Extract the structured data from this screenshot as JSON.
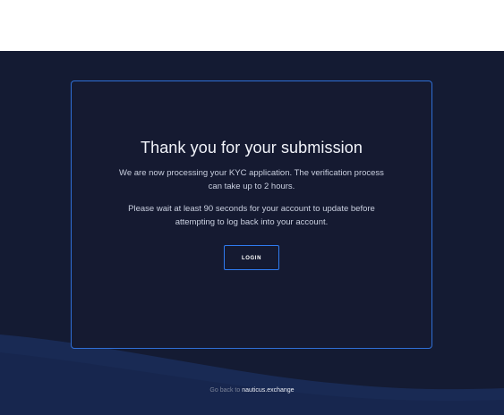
{
  "confirmation": {
    "title": "Thank you for your submission",
    "paragraph_1": "We are now processing your KYC application. The verification process can take up to 2 hours.",
    "paragraph_2": "Please wait at least 90 seconds for your account to update before attempting to log back into your account.",
    "login_label": "LOGIN"
  },
  "footer": {
    "prefix": "Go back to ",
    "link_text": "nauticus.exchange"
  },
  "colors": {
    "background": "#141b33",
    "card_background": "#151a31",
    "card_border": "#2f6fd6",
    "button_border": "#2f7bf0",
    "wave": "#1a2d5a"
  }
}
